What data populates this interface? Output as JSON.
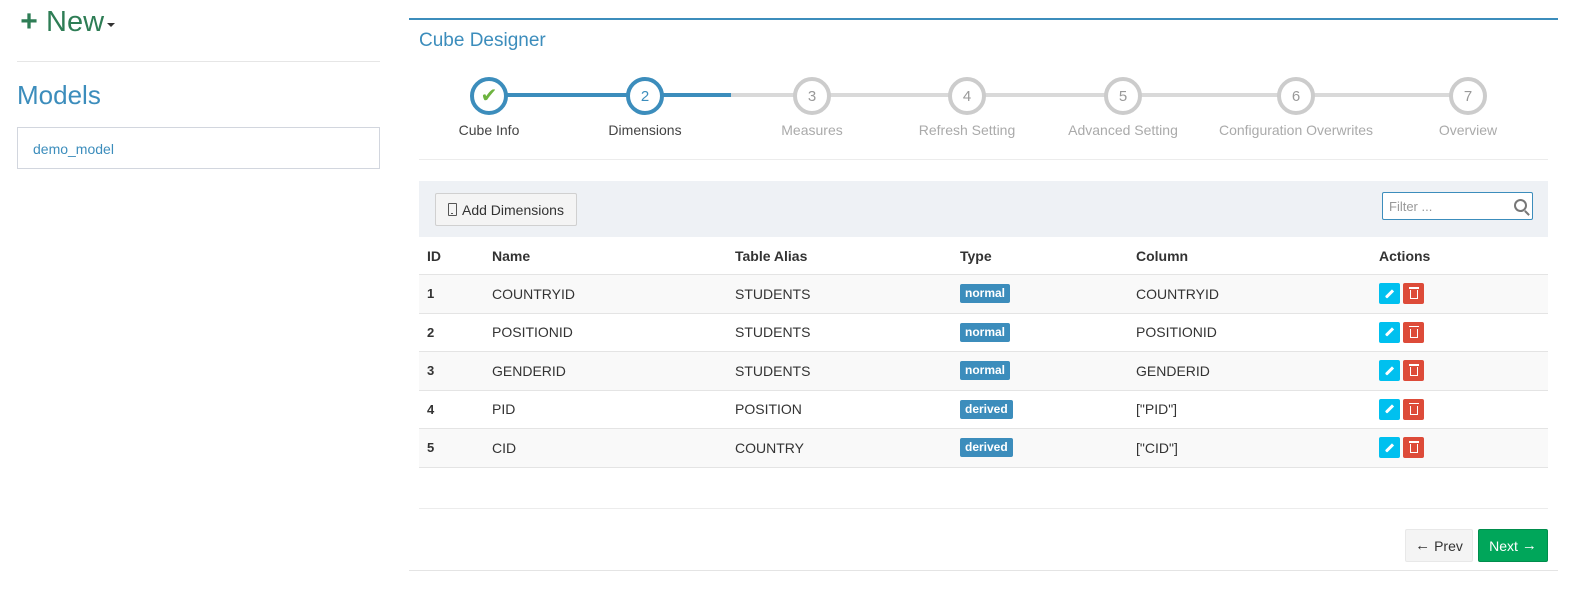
{
  "new_button": {
    "label": "New"
  },
  "models": {
    "title": "Models",
    "items": [
      {
        "label": "demo_model"
      }
    ]
  },
  "panel": {
    "title": "Cube Designer"
  },
  "steps": [
    {
      "number": "1",
      "label": "Cube Info",
      "state": "done"
    },
    {
      "number": "2",
      "label": "Dimensions",
      "state": "active"
    },
    {
      "number": "3",
      "label": "Measures",
      "state": "pending"
    },
    {
      "number": "4",
      "label": "Refresh Setting",
      "state": "pending"
    },
    {
      "number": "5",
      "label": "Advanced Setting",
      "state": "pending"
    },
    {
      "number": "6",
      "label": "Configuration Overwrites",
      "state": "pending"
    },
    {
      "number": "7",
      "label": "Overview",
      "state": "pending"
    }
  ],
  "toolbar": {
    "add_label": "Add Dimensions",
    "filter_placeholder": "Filter ..."
  },
  "table": {
    "headers": {
      "id": "ID",
      "name": "Name",
      "alias": "Table Alias",
      "type": "Type",
      "column": "Column",
      "actions": "Actions"
    },
    "rows": [
      {
        "id": "1",
        "name": "COUNTRYID",
        "alias": "STUDENTS",
        "type": "normal",
        "column": "COUNTRYID"
      },
      {
        "id": "2",
        "name": "POSITIONID",
        "alias": "STUDENTS",
        "type": "normal",
        "column": "POSITIONID"
      },
      {
        "id": "3",
        "name": "GENDERID",
        "alias": "STUDENTS",
        "type": "normal",
        "column": "GENDERID"
      },
      {
        "id": "4",
        "name": "PID",
        "alias": "POSITION",
        "type": "derived",
        "column": "[\"PID\"]"
      },
      {
        "id": "5",
        "name": "CID",
        "alias": "COUNTRY",
        "type": "derived",
        "column": "[\"CID\"]"
      }
    ]
  },
  "footer": {
    "prev_label": "Prev",
    "next_label": "Next"
  },
  "colors": {
    "primary": "#3c8dbc",
    "success": "#00a65a",
    "danger": "#dd4b39",
    "info": "#00c0ef",
    "check": "#6db33f",
    "new": "#2e7d55"
  }
}
